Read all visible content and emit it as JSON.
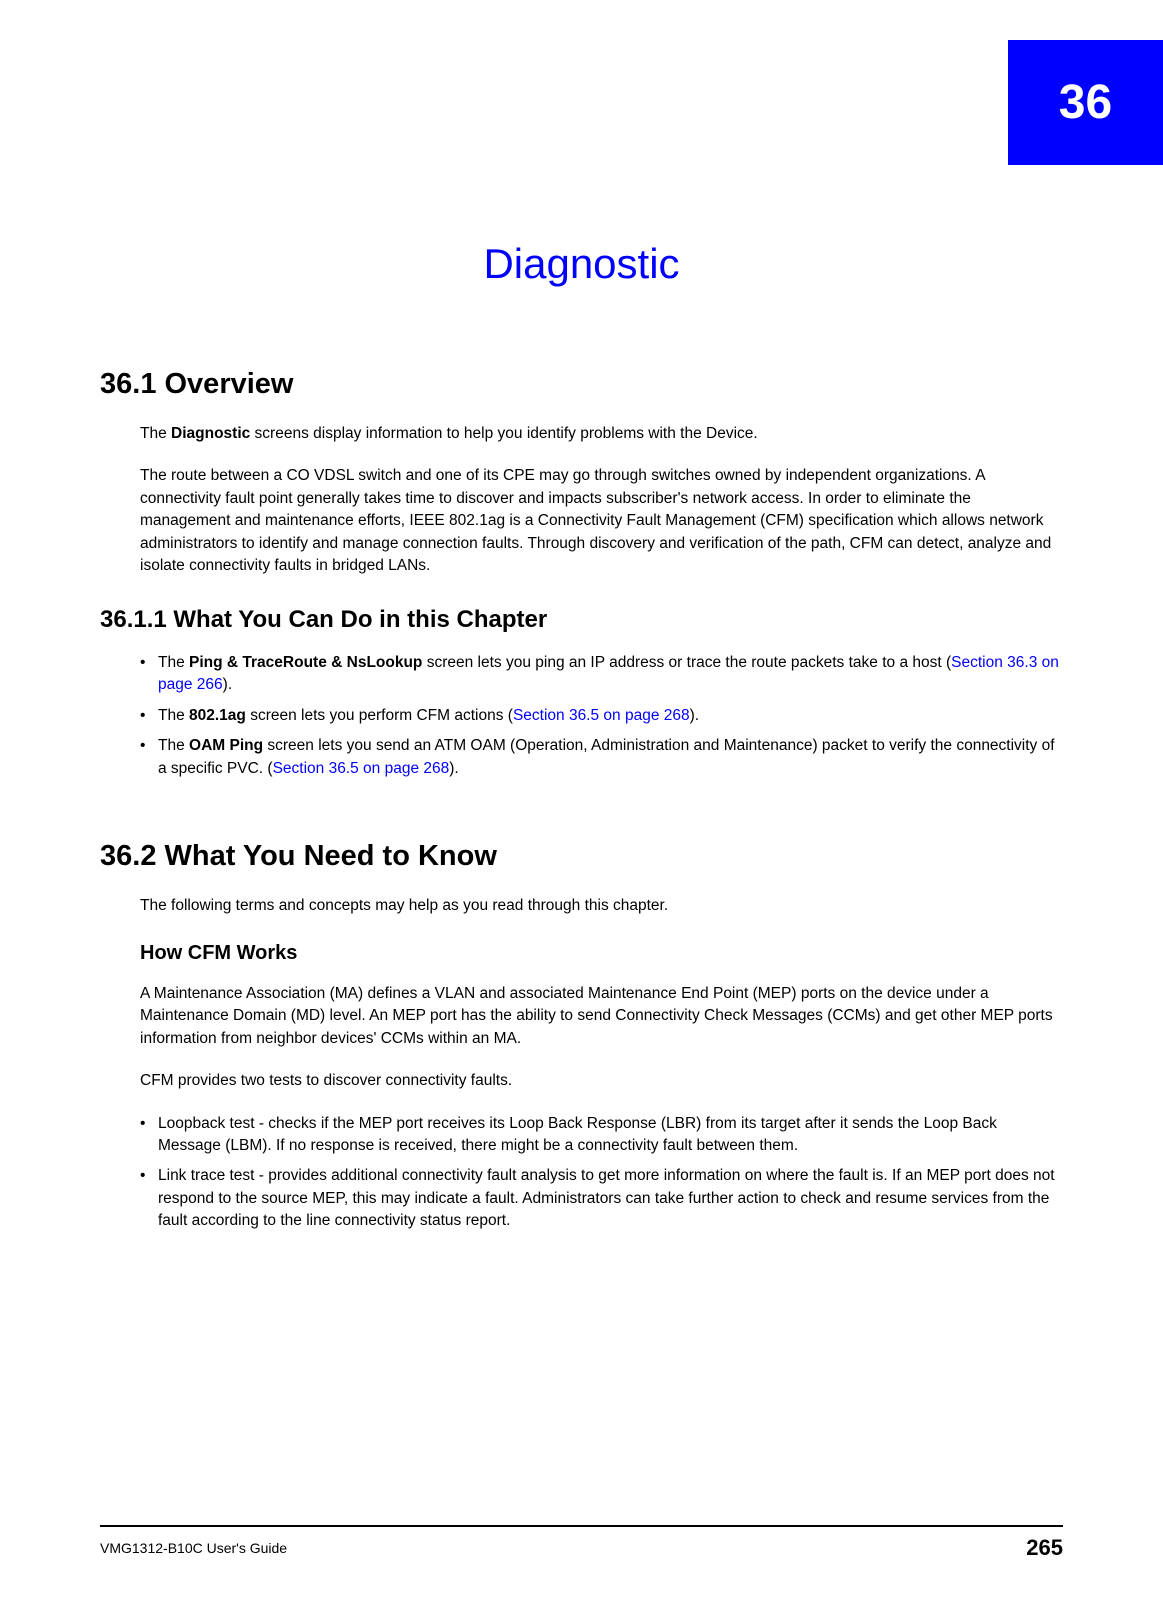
{
  "chapter": {
    "number": "36",
    "title": "Diagnostic"
  },
  "sections": {
    "overview": {
      "heading": "36.1  Overview",
      "intro_prefix": "The ",
      "intro_bold": "Diagnostic",
      "intro_suffix": " screens display information to help you identify problems with the Device.",
      "para2": "The route between a CO VDSL switch and one of its CPE may go through switches owned by independent organizations. A connectivity fault point generally takes time to discover and impacts subscriber's network access. In order to eliminate the management and maintenance efforts, IEEE 802.1ag is a Connectivity Fault Management (CFM) specification which allows network administrators to identify and manage connection faults. Through discovery and verification of the path, CFM can detect, analyze and isolate connectivity faults in bridged LANs."
    },
    "whatyoucando": {
      "heading": "36.1.1  What You Can Do in this Chapter",
      "bullets": [
        {
          "prefix": "The ",
          "bold": "Ping & TraceRoute & NsLookup",
          "mid": " screen lets you ping an IP address or trace the route packets take to a host (",
          "link": "Section 36.3 on page 266",
          "suffix": ")."
        },
        {
          "prefix": "The ",
          "bold": "802.1ag",
          "mid": " screen lets you perform CFM actions (",
          "link": "Section 36.5 on page 268",
          "suffix": ")."
        },
        {
          "prefix": "The ",
          "bold": "OAM Ping",
          "mid": " screen lets you send an ATM OAM (Operation, Administration and Maintenance) packet to verify the connectivity of a specific PVC. (",
          "link": "Section 36.5 on page 268",
          "suffix": ")."
        }
      ]
    },
    "needtoknow": {
      "heading": "36.2  What You Need to Know",
      "intro": "The following terms and concepts may help as you read through this chapter.",
      "cfm_heading": "How CFM Works",
      "cfm_para1": "A Maintenance Association (MA) defines a VLAN and associated Maintenance End Point (MEP) ports on the device under a Maintenance Domain (MD) level. An MEP port has the ability to send Connectivity Check Messages (CCMs) and get other MEP ports information from neighbor devices' CCMs within an MA.",
      "cfm_para2": "CFM provides two tests to discover connectivity faults.",
      "cfm_bullets": [
        "Loopback test - checks if the MEP port receives its Loop Back Response (LBR) from its target after it sends the Loop Back Message (LBM). If no response is received, there might be a connectivity fault between them.",
        "Link trace test - provides additional connectivity fault analysis to get more information on where the fault is. If an MEP port does not respond to the source MEP, this may indicate a fault. Administrators can take further action to check and resume services from the fault according to the line connectivity status report."
      ]
    }
  },
  "footer": {
    "guide": "VMG1312-B10C User's Guide",
    "page": "265"
  }
}
